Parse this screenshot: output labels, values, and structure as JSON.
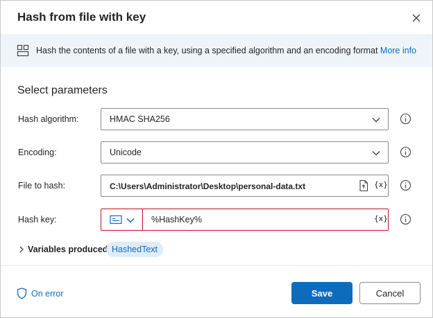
{
  "dialog": {
    "title": "Hash from file with key"
  },
  "banner": {
    "text": "Hash the contents of a file with a key, using a specified algorithm and an encoding format",
    "link": "More info",
    "icon": "action-module-icon"
  },
  "section": {
    "title": "Select parameters"
  },
  "params": {
    "hash_algorithm": {
      "label": "Hash algorithm:",
      "value": "HMAC SHA256"
    },
    "encoding": {
      "label": "Encoding:",
      "value": "Unicode"
    },
    "file_to_hash": {
      "label": "File to hash:",
      "value": "C:\\Users\\Administrator\\Desktop\\personal-data.txt"
    },
    "hash_key": {
      "label": "Hash key:",
      "value": "%HashKey%"
    }
  },
  "variable_token": "{x}",
  "variables": {
    "label": "Variables produced",
    "items": [
      "HashedText"
    ]
  },
  "footer": {
    "on_error": "On error",
    "save": "Save",
    "cancel": "Cancel"
  },
  "colors": {
    "accent": "#0f6cbd",
    "error_border": "#c50f1f",
    "banner_bg": "#eff4f9",
    "pill_bg": "#deecf9"
  }
}
